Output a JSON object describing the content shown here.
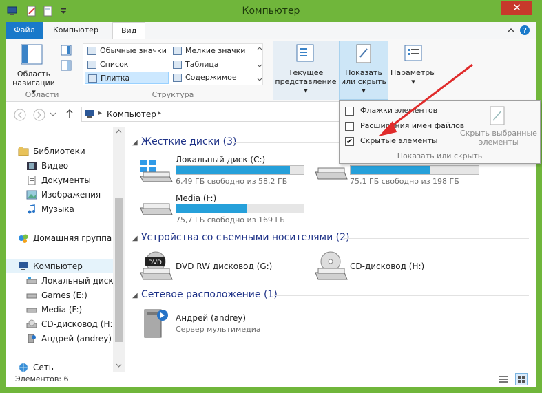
{
  "window": {
    "title": "Компьютер",
    "close_glyph": "✕"
  },
  "tabs": {
    "file": "Файл",
    "computer": "Компьютер",
    "view": "Вид"
  },
  "ribbon": {
    "nav_pane": "Область навигации",
    "nav_pane_line1": "Область",
    "nav_pane_line2": "навигации",
    "group_areas": "Области",
    "layout": [
      "Обычные значки",
      "Мелкие значки",
      "Список",
      "Таблица",
      "Плитка",
      "Содержимое"
    ],
    "group_structure": "Структура",
    "current_view_line1": "Текущее",
    "current_view_line2": "представление",
    "show_hide_line1": "Показать",
    "show_hide_line2": "или скрыть",
    "params": "Параметры"
  },
  "address": {
    "path": "Компьютер"
  },
  "dropdown": {
    "items": [
      {
        "label": "Флажки элементов",
        "checked": false
      },
      {
        "label": "Расширения имен файлов",
        "checked": false
      },
      {
        "label": "Скрытые элементы",
        "checked": true
      }
    ],
    "check_glyph": "✔",
    "hide_selected_line1": "Скрыть выбранные",
    "hide_selected_line2": "элементы",
    "group": "Показать или скрыть"
  },
  "nav": {
    "libraries": "Библиотеки",
    "video": "Видео",
    "documents": "Документы",
    "images": "Изображения",
    "music": "Музыка",
    "homegroup": "Домашняя группа",
    "computer": "Компьютер",
    "local_disk": "Локальный диск (C",
    "games": "Games (E:)",
    "media": "Media (F:)",
    "cd": "CD-дисковод (H:)",
    "andrey": "Андрей (andrey)",
    "network": "Сеть"
  },
  "sections": {
    "hard_drives": "Жесткие диски (3)",
    "removable": "Устройства со съемными носителями (2)",
    "network": "Сетевое расположение (1)"
  },
  "drives": [
    {
      "name": "Локальный диск (C:)",
      "free": "6,49 ГБ свободно из 58,2 ГБ",
      "used_fraction": 0.89
    },
    {
      "name": "",
      "free": "75,1 ГБ свободно из 198 ГБ",
      "used_fraction": 0.62
    },
    {
      "name": "Media (F:)",
      "free": "75,7 ГБ свободно из 169 ГБ",
      "used_fraction": 0.55
    }
  ],
  "removable": [
    {
      "name": "DVD RW дисковод (G:)",
      "badge": "DVD"
    },
    {
      "name": "CD-дисковод (H:)"
    }
  ],
  "network_items": [
    {
      "name": "Андрей (andrey)",
      "sub": "Сервер мультимедиа"
    }
  ],
  "status": {
    "items": "Элементов: 6"
  },
  "colors": {
    "accent": "#26a0da",
    "frame": "#70b63b",
    "arrow": "#e02b2b",
    "file_tab": "#1979ca"
  }
}
